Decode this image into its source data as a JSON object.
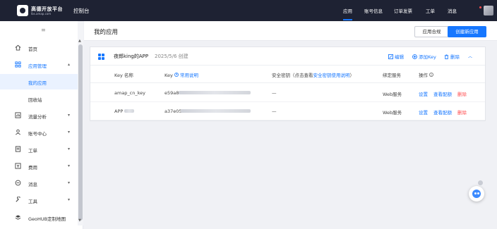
{
  "topbar": {
    "brand_title": "高德开放平台",
    "brand_sub": "lbs.amap.com",
    "console": "控制台",
    "nav": [
      "应用",
      "账号信息",
      "订单发票",
      "工单",
      "消息"
    ],
    "active_nav": "应用"
  },
  "sidebar": {
    "items": [
      {
        "label": "首页",
        "icon": "home-icon"
      },
      {
        "label": "应用管理",
        "icon": "grid-icon",
        "chev": "▴"
      },
      {
        "label": "我的应用"
      },
      {
        "label": "回收站"
      },
      {
        "label": "流量分析",
        "icon": "chart-icon",
        "chev": "▾"
      },
      {
        "label": "账号中心",
        "icon": "user-icon",
        "chev": "▾"
      },
      {
        "label": "工单",
        "icon": "ticket-icon",
        "chev": "▾"
      },
      {
        "label": "费用",
        "icon": "bill-icon",
        "chev": "▾"
      },
      {
        "label": "消息",
        "icon": "bell-icon",
        "chev": "▾"
      },
      {
        "label": "工具",
        "icon": "wrench-icon",
        "chev": "▾"
      },
      {
        "label": "GeoHUB定制地图",
        "icon": "layers-icon"
      }
    ]
  },
  "page": {
    "title": "我的应用",
    "btn_compliance": "应用合规",
    "btn_create": "创建新应用"
  },
  "app_card": {
    "name": "夜郎king的APP",
    "date": "2025/5/6 创建",
    "edit": "编辑",
    "add_key": "添加Key",
    "delete": "删除",
    "collapse": "︿",
    "columns": {
      "key_name": "Key 名称",
      "key": "Key",
      "key_help": "常用说明",
      "secret": "安全密钥（点击查看",
      "secret_link": "安全密钥使用说明",
      "secret_end": "）",
      "service": "绑定服务",
      "ops": "操作"
    },
    "rows": [
      {
        "name": "amap_cn_key",
        "key_prefix": "e59a8",
        "secret": "—",
        "service": "Web服务",
        "ops": [
          "设置",
          "查看配额",
          "删除"
        ]
      },
      {
        "name": "APP",
        "key_prefix": "a37e05",
        "secret": "—",
        "service": "Web服务",
        "ops": [
          "设置",
          "查看配额",
          "删除"
        ]
      }
    ]
  },
  "colors": {
    "accent": "#1677ff",
    "danger": "#ff4d4f",
    "topbar": "#1e2233"
  }
}
